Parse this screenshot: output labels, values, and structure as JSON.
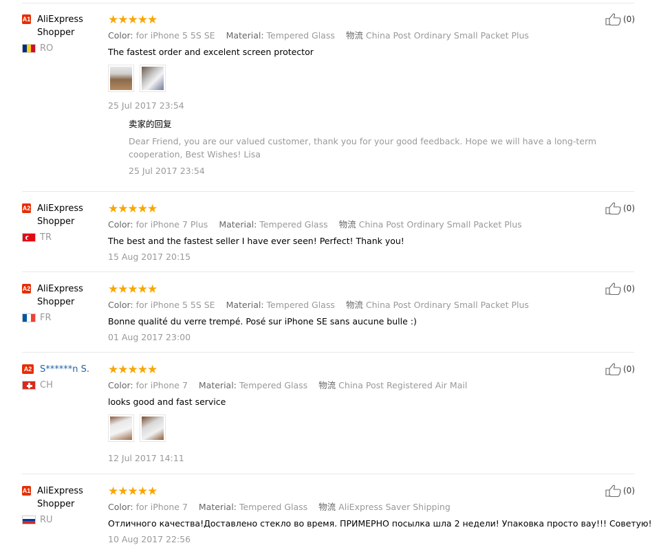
{
  "reviews": [
    {
      "level": "A1",
      "user": "AliExpress Shopper",
      "user_color": "#000000",
      "country": "RO",
      "stars": "★★★★★",
      "color_label": "Color:",
      "color": "for iPhone 5 5S SE",
      "material_label": "Material:",
      "material": "Tempered Glass",
      "shipping_label": "物流",
      "shipping": "China Post Ordinary Small Packet Plus",
      "text": "The fastest order and excelent screen protector",
      "date": "25 Jul 2017 23:54",
      "likes": "(0)",
      "reply": {
        "title": "卖家的回复",
        "text": "Dear Friend, you are our valued customer, thank you for your good feedback. Hope we will have a long-term cooperation, Best Wishes! Lisa",
        "date": "25 Jul 2017 23:54"
      }
    },
    {
      "level": "A2",
      "user": "AliExpress Shopper",
      "country": "TR",
      "stars": "★★★★★",
      "color_label": "Color:",
      "color": "for iPhone 7 Plus",
      "material_label": "Material:",
      "material": "Tempered Glass",
      "shipping_label": "物流",
      "shipping": "China Post Ordinary Small Packet Plus",
      "text": "The best and the fastest seller I have ever seen! Perfect! Thank you!",
      "date": "15 Aug 2017 20:15",
      "likes": "(0)"
    },
    {
      "level": "A2",
      "user": "AliExpress Shopper",
      "country": "FR",
      "stars": "★★★★★",
      "color_label": "Color:",
      "color": "for iPhone 5 5S SE",
      "material_label": "Material:",
      "material": "Tempered Glass",
      "shipping_label": "物流",
      "shipping": "China Post Ordinary Small Packet Plus",
      "text": "Bonne qualité du verre trempé. Posé sur iPhone SE sans aucune bulle :)",
      "date": "01 Aug 2017 23:00",
      "likes": "(0)"
    },
    {
      "level": "A2",
      "user": "S******n S.",
      "country": "CH",
      "stars": "★★★★★",
      "color_label": "Color:",
      "color": "for iPhone 7",
      "material_label": "Material:",
      "material": "Tempered Glass",
      "shipping_label": "物流",
      "shipping": "China Post Registered Air Mail",
      "text": "looks good and fast service",
      "date": "12 Jul 2017 14:11",
      "likes": "(0)"
    },
    {
      "level": "A1",
      "user": "AliExpress Shopper",
      "country": "RU",
      "stars": "★★★★★",
      "color_label": "Color:",
      "color": "for iPhone 7",
      "material_label": "Material:",
      "material": "Tempered Glass",
      "shipping_label": "物流",
      "shipping": "AliExpress Saver Shipping",
      "text": "Отличного качества!Доставлено стекло во время. ПРИМЕРНО посылка шла 2 недели! Упаковка просто вау!!! Советую!",
      "date": "10 Aug 2017 22:56",
      "likes": "(0)"
    }
  ],
  "colors": {
    "star": "#f9a602",
    "level_badge": "#e62e04",
    "username_link": "#1e62a8"
  }
}
